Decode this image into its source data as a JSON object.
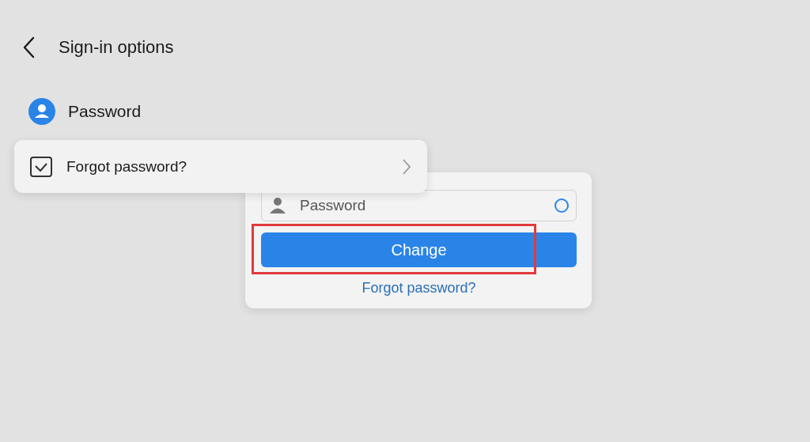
{
  "header": {
    "title": "Sign-in options"
  },
  "section": {
    "title": "Password"
  },
  "menu_item": {
    "label": "Forgot password?"
  },
  "dialog": {
    "field": {
      "placeholder": "Password"
    },
    "button": {
      "label": "Change",
      "highlighted": true
    },
    "link": "Forgot password?"
  }
}
